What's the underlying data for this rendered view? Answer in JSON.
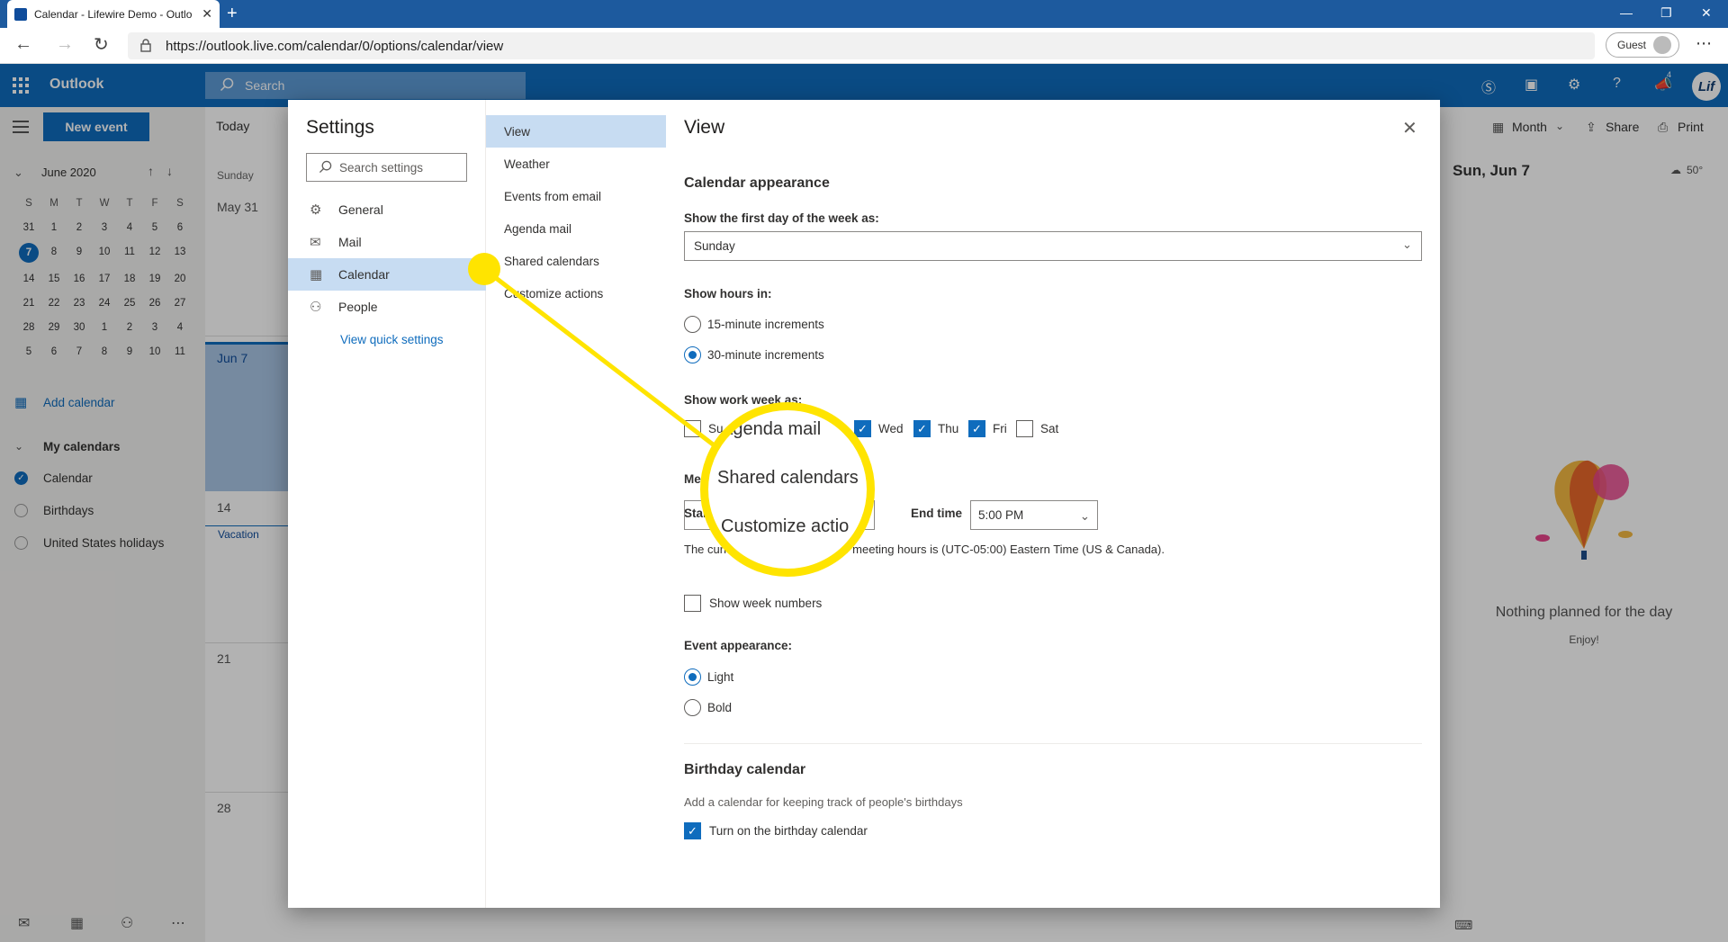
{
  "browser": {
    "tab_title": "Calendar - Lifewire Demo - Outlo",
    "url": "https://outlook.live.com/calendar/0/options/calendar/view",
    "guest_label": "Guest"
  },
  "outlook": {
    "brand": "Outlook",
    "search_placeholder": "Search",
    "user_initials": "Lif",
    "notification_count": "4"
  },
  "left_pane": {
    "new_event": "New event",
    "month_label": "June 2020",
    "dow": [
      "S",
      "M",
      "T",
      "W",
      "T",
      "F",
      "S"
    ],
    "days": [
      "31",
      "1",
      "2",
      "3",
      "4",
      "5",
      "6",
      "7",
      "8",
      "9",
      "10",
      "11",
      "12",
      "13",
      "14",
      "15",
      "16",
      "17",
      "18",
      "19",
      "20",
      "21",
      "22",
      "23",
      "24",
      "25",
      "26",
      "27",
      "28",
      "29",
      "30",
      "1",
      "2",
      "3",
      "4",
      "5",
      "6",
      "7",
      "8",
      "9",
      "10",
      "11"
    ],
    "add_calendar": "Add calendar",
    "my_calendars": "My calendars",
    "calendars": [
      "Calendar",
      "Birthdays",
      "United States holidays"
    ]
  },
  "calendar": {
    "today": "Today",
    "sunday": "Sunday",
    "may31": "May 31",
    "jun7": "Jun 7",
    "d14": "14",
    "vacation": "Vacation",
    "d21": "21",
    "d28": "28",
    "view_mode": "Month",
    "share": "Share",
    "print": "Print",
    "day_header": "Sun, Jun 7",
    "weather": "50°",
    "empty_title": "Nothing planned for the day",
    "empty_sub": "Enjoy!"
  },
  "settings": {
    "title": "Settings",
    "search_placeholder": "Search settings",
    "categories": [
      "General",
      "Mail",
      "Calendar",
      "People"
    ],
    "quick": "View quick settings",
    "subcategories": [
      "View",
      "Weather",
      "Events from email",
      "Agenda mail",
      "Shared calendars",
      "Customize actions"
    ],
    "view_title": "View",
    "appearance_heading": "Calendar appearance",
    "first_day_label": "Show the first day of the week as:",
    "first_day_value": "Sunday",
    "hours_label": "Show hours in:",
    "hours_options": [
      "15-minute increments",
      "30-minute increments"
    ],
    "work_week_label": "Show work week as:",
    "work_days": [
      "Su",
      "Wed",
      "Thu",
      "Fri",
      "Sat"
    ],
    "meeting_label": "Me",
    "start_label": "Star",
    "end_label": "End time",
    "end_value": "5:00 PM",
    "tz_line_prefix": "The curr",
    "tz_line_suffix": "ur meeting hours is (UTC-05:00) Eastern Time (US & Canada).",
    "week_numbers": "Show week numbers",
    "event_appearance": "Event appearance:",
    "event_options": [
      "Light",
      "Bold"
    ],
    "birthday_heading": "Birthday calendar",
    "birthday_desc": "Add a calendar for keeping track of people's birthdays",
    "birthday_toggle": "Turn on the birthday calendar"
  },
  "callout": {
    "lines": [
      "Agenda mail",
      "Shared calendars",
      "Customize actio"
    ],
    "color": "#ffe400"
  },
  "colors": {
    "accent": "#0f6cbd",
    "highlight": "#ffe400"
  }
}
